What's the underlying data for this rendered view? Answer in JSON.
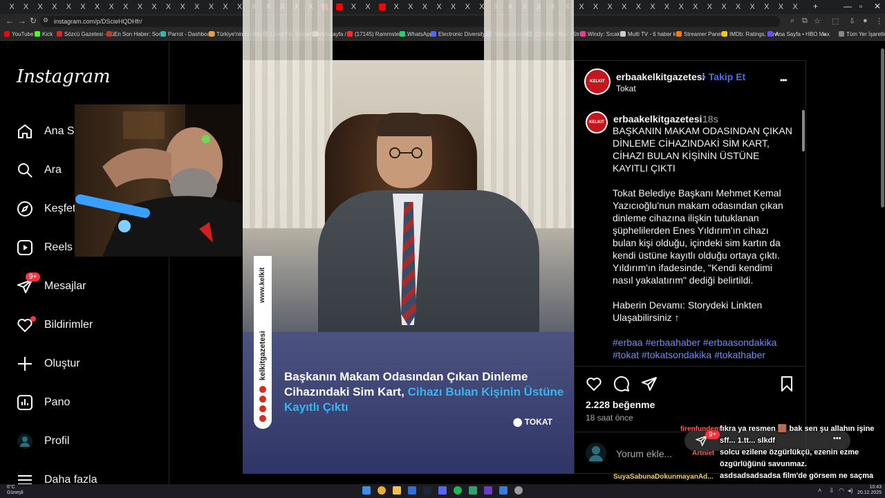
{
  "browser": {
    "url": "instagram.com/p/DScieHQDHfr/",
    "bookmarks": [
      "YouTube",
      "Kick",
      "Sözcü Gazetesi - Tü...",
      "En Son Haber: Son...",
      "Parrot - Dashboard",
      "Türkiye'nin En Büyü...",
      "Livad For Streamers",
      "Anasayfa / X",
      "(17145) Rammstein...",
      "WhatsApp",
      "Electronic Diversity...",
      "Google Gemini",
      "(19) Alert Box / Stre...",
      "Windy: Sıcaklık",
      "Multi TV - 6 haber k...",
      "Streamer Panel",
      "IMDb: Ratings, Revi...",
      "Ana Sayfa • HBO Max",
      "Tüm Yer İşaretleri"
    ],
    "tab_close_glyph": "X",
    "new_tab_glyph": "+",
    "bookmarks_more": "»"
  },
  "sidebar": {
    "logo": "Instagram",
    "items": [
      {
        "label": "Ana Sayfa",
        "icon": "home-icon"
      },
      {
        "label": "Ara",
        "icon": "search-icon"
      },
      {
        "label": "Keşfet",
        "icon": "compass-icon"
      },
      {
        "label": "Reels",
        "icon": "reels-icon"
      },
      {
        "label": "Mesajlar",
        "icon": "messenger-icon",
        "badge": "9+"
      },
      {
        "label": "Bildirimler",
        "icon": "heart-icon"
      },
      {
        "label": "Oluştur",
        "icon": "plus-icon"
      },
      {
        "label": "Pano",
        "icon": "dashboard-icon"
      },
      {
        "label": "Profil",
        "icon": "avatar-icon"
      },
      {
        "label": "Daha fazla",
        "icon": "menu-icon"
      }
    ]
  },
  "post": {
    "image_headline_white": "Başkanın Makam Odasından Çıkan Dinleme Cihazındaki Sim Kart,",
    "image_headline_blue": "Cihazı Bulan Kişinin Üstüne Kayıtlı Çıktı",
    "image_location": "TOKAT",
    "image_site": "www.kelkit",
    "image_brand": "kelkitgazetesi",
    "avatar_text": "KELKIT"
  },
  "panel": {
    "username": "erbaakelkitgazetesi",
    "follow_label": "Takip Et",
    "follow_separator": "•",
    "location": "Tokat",
    "more_glyph": "•••",
    "caption_time": "18s",
    "caption_title": "BAŞKANIN MAKAM ODASINDAN ÇIKAN DİNLEME CİHAZINDAKİ SİM KART, CİHAZI BULAN KİŞİNİN ÜSTÜNE KAYITLI ÇIKTI",
    "caption_body": "Tokat Belediye Başkanı Mehmet Kemal Yazıcıoğlu'nun makam odasından çıkan dinleme cihazına ilişkin tutuklanan şüphelilerden Enes Yıldırım'ın cihazı bulan kişi olduğu, içindeki sim kartın da kendi üstüne kayıtlı olduğu ortaya çıktı. Yıldırım'ın ifadesinde, \"Kendi kendimi nasıl yakalatırım\" dediği belirtildi.",
    "caption_more": "Haberin Devamı: Storydeki Linkten Ulaşabilirsiniz ↑",
    "hashtags": "#erbaa #erbaahaber #erbaasondakika #tokat #tokatsondakika #tokathaber",
    "likes": "2.228 beğenme",
    "posted_ago": "18 saat önce",
    "comment_placeholder": "Yorum ekle..."
  },
  "stream_overlay": {
    "messages_badge": "9+",
    "chat_user_1": "firenfundem",
    "chat_user_2": "Artniet",
    "chat_user_3": "SuyaSabunaDokunmayanAd...",
    "chat_lines": [
      "fıkra ya resmen 🟫 bak sen şu allahın işine",
      "sff... 1.tt... slkdf",
      "solcu ezilene özgürlükçü, ezenin ezme özgürlüğünü savunmaz.",
      "asdsadsadsadsa film'de görsem ne saçma sahne derim"
    ]
  },
  "taskbar": {
    "weather_temp": "6°C",
    "weather_desc": "Güneşli",
    "time": "10:43",
    "date": "20.12.2025"
  },
  "colors": {
    "accent_blue": "#4b6bf5",
    "hashtag_blue": "#6f8ef5",
    "badge_red": "#ff3040",
    "headline_blue": "#35b6f0"
  }
}
